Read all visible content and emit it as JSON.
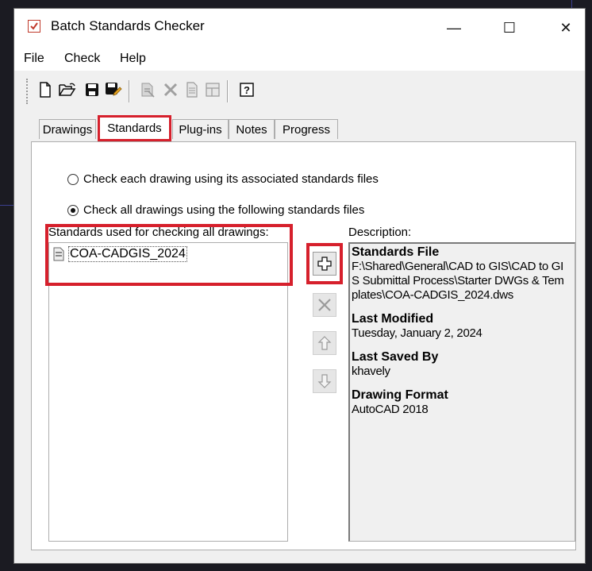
{
  "window": {
    "title": "Batch Standards Checker",
    "controls": {
      "minimize": "—",
      "maximize": "☐",
      "close": "✕"
    }
  },
  "menu": [
    "File",
    "Check",
    "Help"
  ],
  "tabs": [
    "Drawings",
    "Standards",
    "Plug-ins",
    "Notes",
    "Progress"
  ],
  "active_tab": "Standards",
  "options": {
    "option1": "Check each drawing using its associated standards files",
    "option2": "Check all drawings using the following standards files",
    "selected": 2
  },
  "list": {
    "label": "Standards used for checking all drawings:",
    "items": [
      "COA-CADGIS_2024"
    ]
  },
  "description": {
    "label": "Description:",
    "sections": [
      {
        "heading": "Standards File",
        "value": "F:\\Shared\\General\\CAD to GIS\\CAD to GIS Submittal Process\\Starter DWGs & Templates\\COA-CADGIS_2024.dws"
      },
      {
        "heading": "Last Modified",
        "value": "Tuesday, January 2, 2024"
      },
      {
        "heading": "Last Saved By",
        "value": "khavely"
      },
      {
        "heading": "Drawing Format",
        "value": "AutoCAD 2018"
      }
    ]
  },
  "colors": {
    "highlight": "#d6202c"
  }
}
